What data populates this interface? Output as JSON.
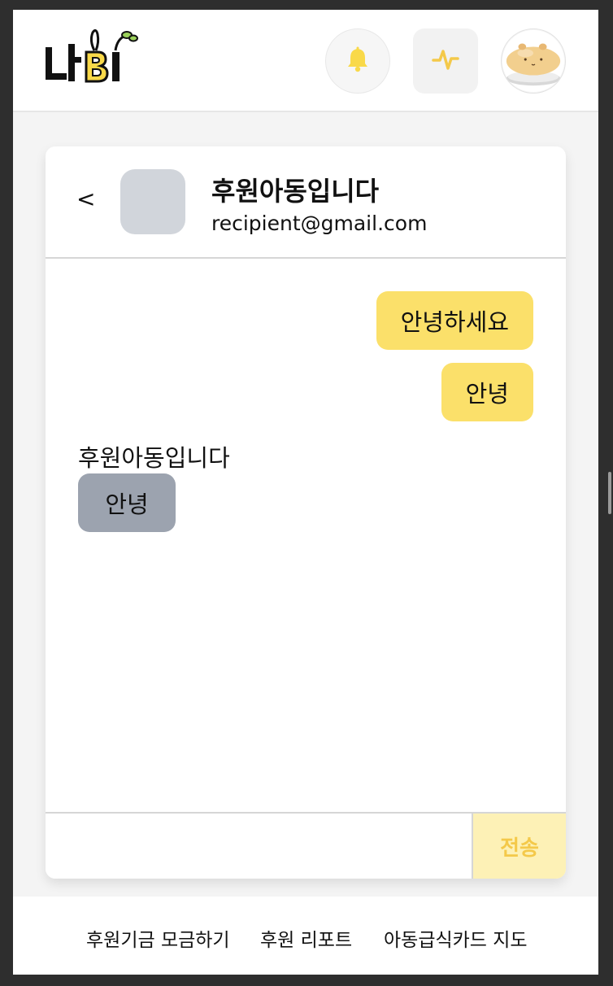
{
  "header": {
    "logo_text": "나비",
    "logo_alt": "NaBI"
  },
  "icons": {
    "bell": "bell-icon",
    "activity": "activity-icon",
    "profile": "profile-avatar-image"
  },
  "colors": {
    "accent": "#fbe06a",
    "accent_strong": "#f4c94a",
    "incoming_bubble": "#9ca3af",
    "send_button_bg": "#fdf1b6"
  },
  "chat": {
    "back_label": "<",
    "recipient_name": "후원아동입니다",
    "recipient_email": "recipient@gmail.com",
    "messages": [
      {
        "direction": "outgoing",
        "text": "안녕하세요"
      },
      {
        "direction": "outgoing",
        "text": "안녕"
      },
      {
        "direction": "incoming",
        "sender": "후원아동입니다",
        "text": "안녕"
      }
    ],
    "input_value": "",
    "send_label": "전송"
  },
  "footer": {
    "links": [
      "후원기금 모금하기",
      "후원 리포트",
      "아동급식카드 지도"
    ]
  }
}
